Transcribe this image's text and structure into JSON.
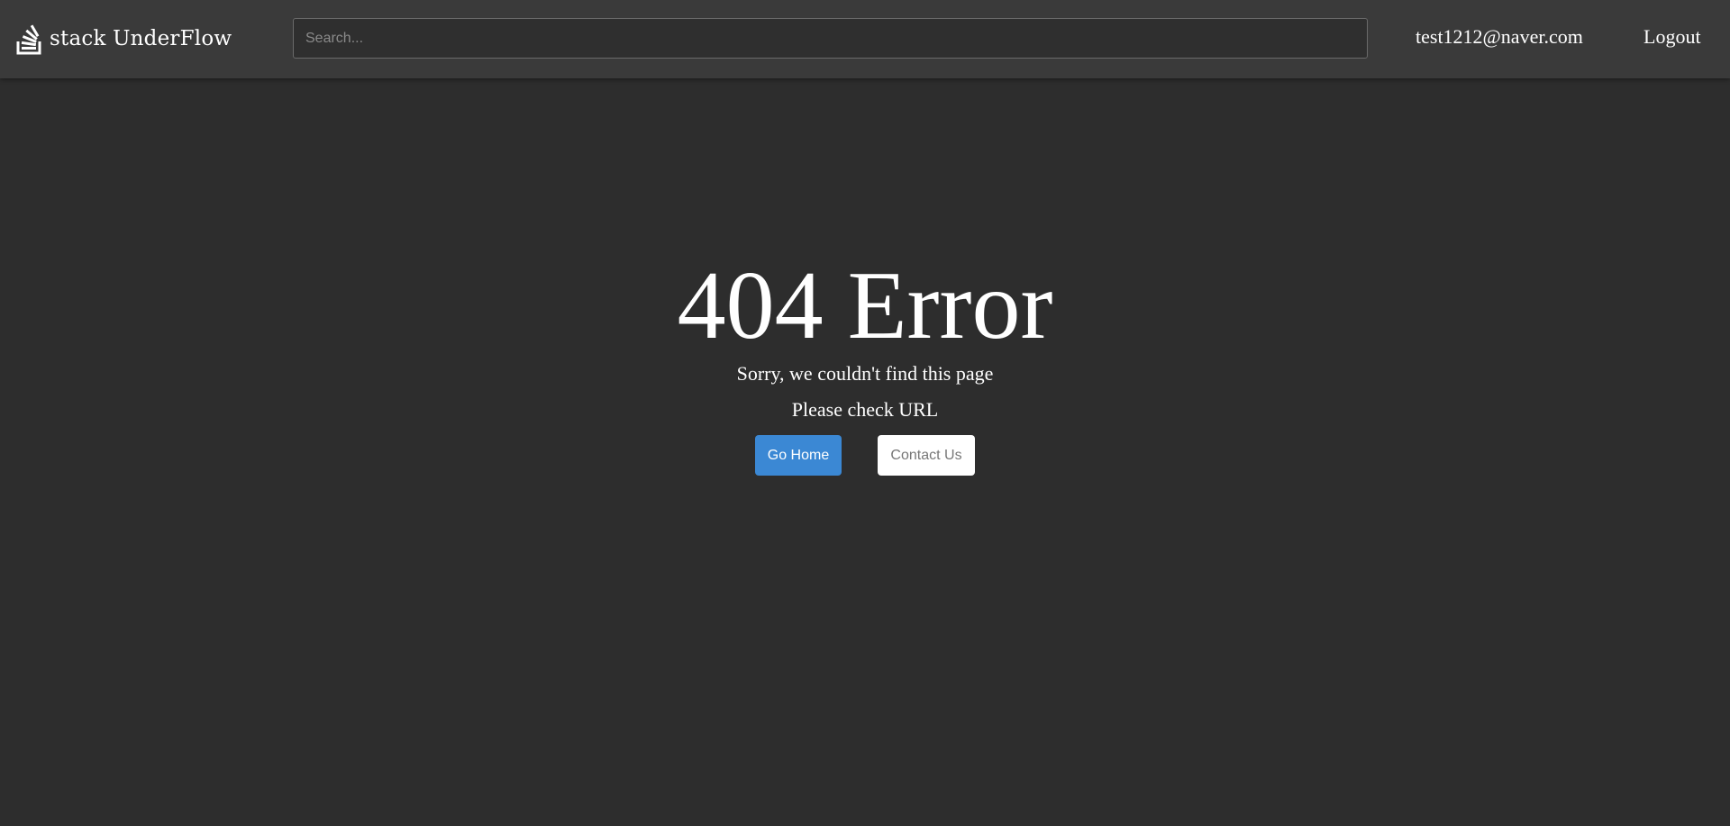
{
  "header": {
    "logo_text": "stack UnderFlow",
    "search_placeholder": "Search...",
    "user_email": "test1212@naver.com",
    "logout_label": "Logout"
  },
  "main": {
    "title": "404 Error",
    "message": "Sorry, we couldn't find this page",
    "hint": "Please check URL",
    "go_home_label": "Go Home",
    "contact_label": "Contact Us"
  },
  "colors": {
    "primary": "#3b88d4",
    "background": "#2d2d2d",
    "header": "#3a3a3a"
  }
}
